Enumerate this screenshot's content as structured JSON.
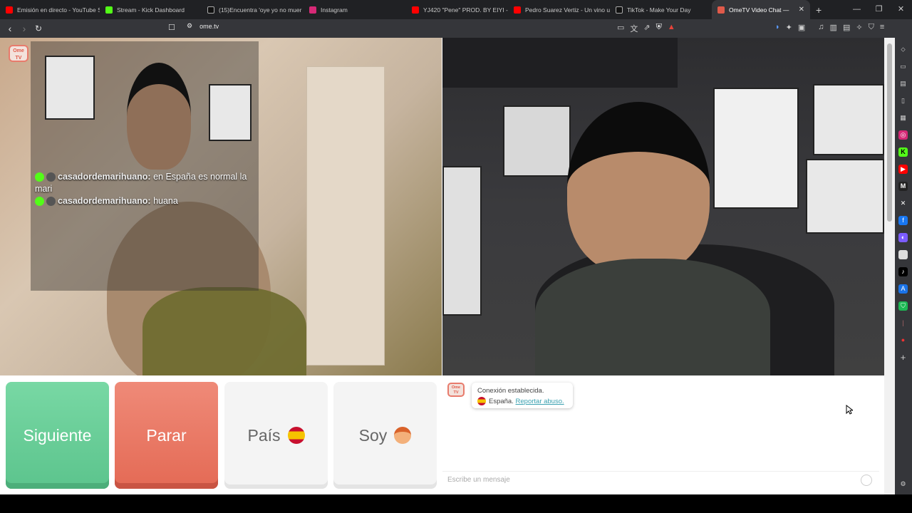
{
  "browser": {
    "tabs": [
      {
        "title": "Emisión en directo - YouTube S",
        "color": "#ff0000"
      },
      {
        "title": "Stream - Kick Dashboard",
        "color": "#53fc18"
      },
      {
        "title": "(15)Encuentra 'oye yo no muer",
        "color": "#111111"
      },
      {
        "title": "Instagram",
        "color": "#d62976"
      },
      {
        "title": "YJ420 \"Pene\" PROD. BY EIYI - Y",
        "color": "#ff0000"
      },
      {
        "title": "Pedro Suarez Vertiz - Un vino u",
        "color": "#ff0000"
      },
      {
        "title": "TikTok - Make Your Day",
        "color": "#111111"
      },
      {
        "title": "OmeTV Video Chat — ",
        "color": "#e05a4a",
        "active": true
      }
    ],
    "close_tab": "✕",
    "new_tab": "+",
    "url": "ome.tv"
  },
  "overlay": {
    "logo_line1": "Ome",
    "logo_line2": "TV",
    "chat": [
      {
        "user": "casadordemarihuano:",
        "text": " en España es normal la mari"
      },
      {
        "user": "casadordemarihuano:",
        "text": " huana"
      }
    ]
  },
  "controls": {
    "next_label": "Siguiente",
    "stop_label": "Parar",
    "country_label": "País",
    "gender_label": "Soy"
  },
  "chat": {
    "system_line1": "Conexión establecida.",
    "system_country": "España.",
    "report_link": "Reportar abuso.",
    "input_placeholder": "Escribe un mensaje"
  },
  "colors": {
    "next": "#5cc48d",
    "stop": "#e46a55",
    "brand": "#e05a4a"
  }
}
